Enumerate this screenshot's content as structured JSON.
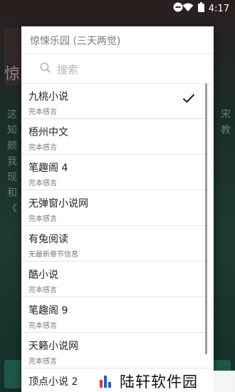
{
  "status_bar": {
    "time": "4:17"
  },
  "dialog": {
    "title": "惊悚乐园 (三天两觉)",
    "search_placeholder": "搜索",
    "items": [
      {
        "name": "九桃小说",
        "sub": "完本感言",
        "selected": true
      },
      {
        "name": "梧州中文",
        "sub": "完本感言"
      },
      {
        "name": "笔趣阁 4",
        "sub": "完本感言"
      },
      {
        "name": "无弹窗小说网",
        "sub": "完本感言"
      },
      {
        "name": "有兔阅读",
        "sub": "无最新章节信息"
      },
      {
        "name": "酷小说",
        "sub": "完本感言"
      },
      {
        "name": "笔趣阁 9",
        "sub": "完本感言"
      },
      {
        "name": "天籁小说网",
        "sub": "完本感言"
      },
      {
        "name": "顶点小说 2",
        "sub": ""
      }
    ]
  },
  "watermark": {
    "text": "陆轩软件园"
  },
  "colors": {
    "accent_bg": "#1f6a55",
    "dialog_bg": "#ffffff"
  }
}
